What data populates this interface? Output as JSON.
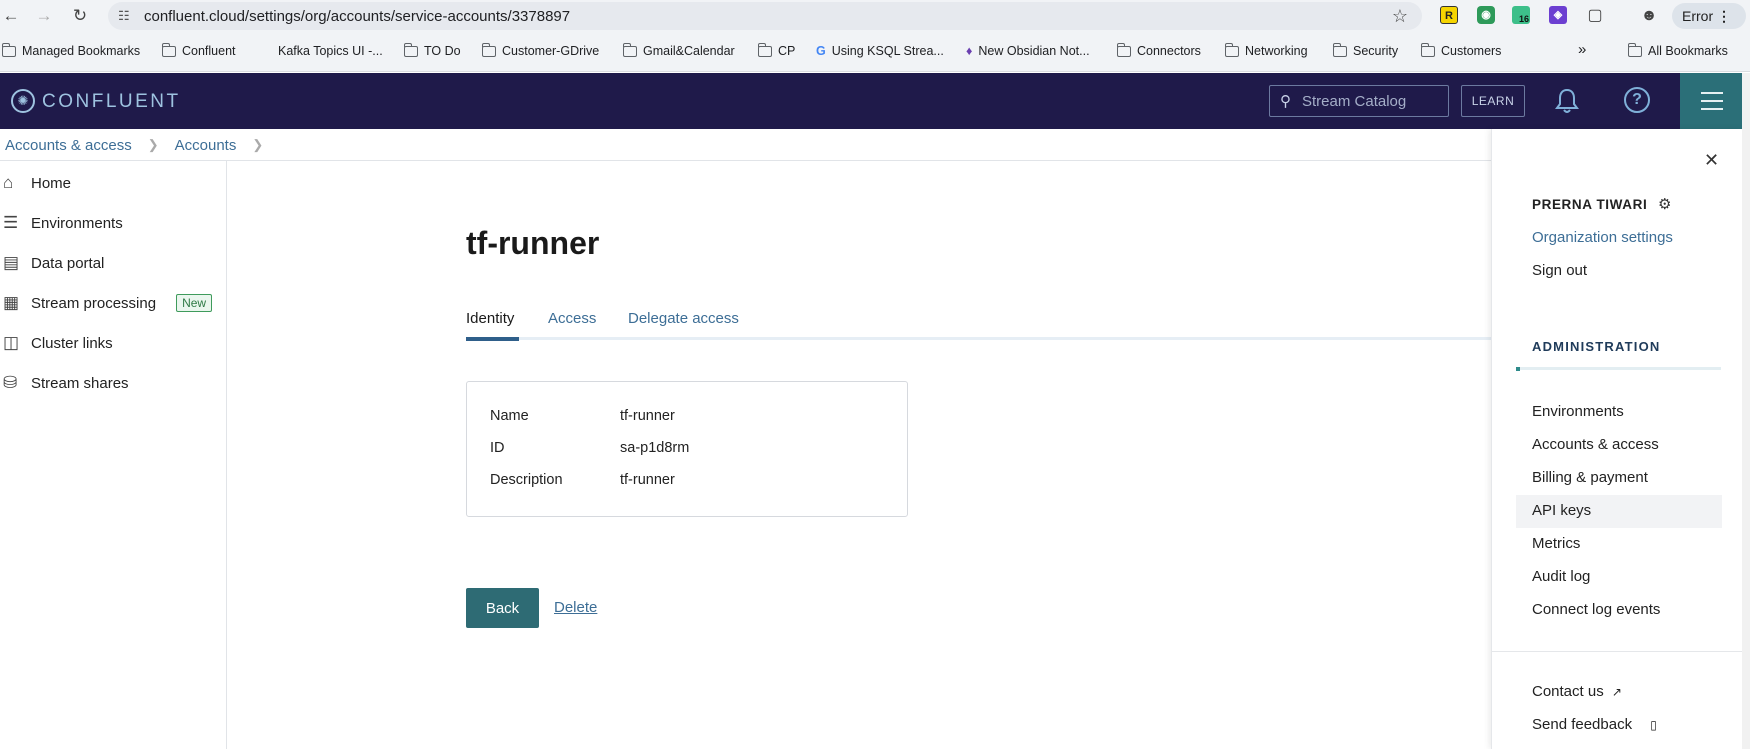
{
  "browser": {
    "url": "confluent.cloud/settings/org/accounts/service-accounts/3378897",
    "error_label": "Error",
    "bookmarks": [
      "Managed Bookmarks",
      "Confluent",
      "Kafka Topics UI -...",
      "TO Do",
      "Customer-GDrive",
      "Gmail&Calendar",
      "CP",
      "Using KSQL Strea...",
      "New Obsidian Not...",
      "Connectors",
      "Networking",
      "Security",
      "Customers"
    ],
    "all_bookmarks": "All Bookmarks",
    "extension_badge": "16"
  },
  "header": {
    "logo_text": "CONFLUENT",
    "search_placeholder": "Stream Catalog",
    "learn_label": "LEARN"
  },
  "breadcrumb": [
    "Accounts & access",
    "Accounts"
  ],
  "sidebar": {
    "items": [
      {
        "label": "Home",
        "icon": "home-icon"
      },
      {
        "label": "Environments",
        "icon": "layers-icon"
      },
      {
        "label": "Data portal",
        "icon": "portal-icon"
      },
      {
        "label": "Stream processing",
        "icon": "processing-icon",
        "badge": "New"
      },
      {
        "label": "Cluster links",
        "icon": "link-icon"
      },
      {
        "label": "Stream shares",
        "icon": "database-icon"
      }
    ]
  },
  "main": {
    "title": "tf-runner",
    "tabs": [
      "Identity",
      "Access",
      "Delegate access"
    ],
    "active_tab": "Identity",
    "fields": [
      {
        "label": "Name",
        "value": "tf-runner"
      },
      {
        "label": "ID",
        "value": "sa-p1d8rm"
      },
      {
        "label": "Description",
        "value": "tf-runner"
      }
    ],
    "back_label": "Back",
    "delete_label": "Delete"
  },
  "panel": {
    "user_name": "PRERNA TIWARI",
    "org_settings": "Organization settings",
    "sign_out": "Sign out",
    "admin_heading": "ADMINISTRATION",
    "admin_items": [
      "Environments",
      "Accounts & access",
      "Billing & payment",
      "API keys",
      "Metrics",
      "Audit log",
      "Connect log events"
    ],
    "contact_us": "Contact us",
    "send_feedback": "Send feedback"
  },
  "colors": {
    "header_bg": "#1f1a4a",
    "accent_teal": "#2e6b74",
    "link_blue": "#3d6e96",
    "badge_green": "#3f9b5c"
  }
}
